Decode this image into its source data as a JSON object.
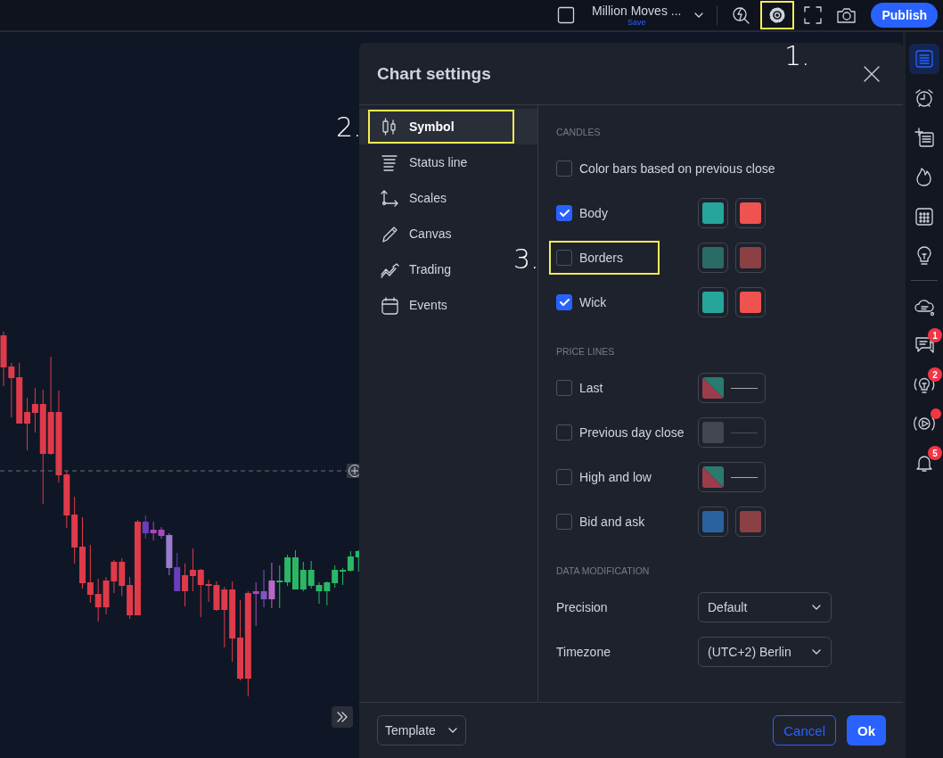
{
  "top_bar": {
    "title": "Million Moves ...",
    "subtitle": "Save",
    "settings_highlighted": true,
    "publish": "Publish"
  },
  "annotations": [
    "1.",
    "2.",
    "3."
  ],
  "dialog": {
    "title": "Chart settings",
    "nav": [
      {
        "label": "Symbol",
        "selected": true,
        "highlighted": true
      },
      {
        "label": "Status line",
        "selected": false,
        "highlighted": false
      },
      {
        "label": "Scales",
        "selected": false,
        "highlighted": false
      },
      {
        "label": "Canvas",
        "selected": false,
        "highlighted": false
      },
      {
        "label": "Trading",
        "selected": false,
        "highlighted": false
      },
      {
        "label": "Events",
        "selected": false,
        "highlighted": false
      }
    ],
    "sections": [
      {
        "heading": "CANDLES",
        "rows": [
          {
            "kind": "check",
            "label": "Color bars based on previous close",
            "checked": false,
            "highlighted": false,
            "swatches": []
          },
          {
            "kind": "check",
            "label": "Body",
            "checked": true,
            "highlighted": false,
            "swatches": [
              {
                "kind": "solid",
                "color": "#26a69a"
              },
              {
                "kind": "solid",
                "color": "#ef5350"
              }
            ]
          },
          {
            "kind": "check",
            "label": "Borders",
            "checked": false,
            "highlighted": true,
            "swatches": [
              {
                "kind": "solid",
                "color": "#2b6b66"
              },
              {
                "kind": "solid",
                "color": "#8b4043"
              }
            ]
          },
          {
            "kind": "check",
            "label": "Wick",
            "checked": true,
            "highlighted": false,
            "swatches": [
              {
                "kind": "solid",
                "color": "#26a69a"
              },
              {
                "kind": "solid",
                "color": "#ef5350"
              }
            ]
          }
        ]
      },
      {
        "heading": "PRICE LINES",
        "rows": [
          {
            "kind": "check",
            "label": "Last",
            "checked": false,
            "highlighted": false,
            "swatches": [
              {
                "kind": "line",
                "parts": [
                  {
                    "color": "#2b7a6e"
                  },
                  {
                    "color": "#9c3c4b"
                  }
                ]
              }
            ]
          },
          {
            "kind": "check",
            "label": "Previous day close",
            "checked": false,
            "highlighted": false,
            "swatches": [
              {
                "kind": "line",
                "parts": [
                  {
                    "color": "#434651"
                  }
                ]
              }
            ]
          },
          {
            "kind": "check",
            "label": "High and low",
            "checked": false,
            "highlighted": false,
            "swatches": [
              {
                "kind": "line",
                "parts": [
                  {
                    "color": "#2b7a6e"
                  },
                  {
                    "color": "#9c3c4b"
                  }
                ]
              }
            ]
          },
          {
            "kind": "check",
            "label": "Bid and ask",
            "checked": false,
            "highlighted": false,
            "swatches": [
              {
                "kind": "solid",
                "color": "#2a62a0"
              },
              {
                "kind": "solid",
                "color": "#8b4043"
              }
            ]
          }
        ]
      },
      {
        "heading": "DATA MODIFICATION",
        "rows": [
          {
            "kind": "select",
            "label": "Precision",
            "value": "Default"
          },
          {
            "kind": "select",
            "label": "Timezone",
            "value": "(UTC+2) Berlin"
          }
        ]
      }
    ],
    "footer": {
      "template": "Template",
      "cancel": "Cancel",
      "ok": "Ok"
    }
  },
  "right_toolbar": [
    {
      "kind": "watchlist",
      "selected": true,
      "dot": false
    },
    {
      "kind": "alarm",
      "selected": false,
      "dot": false
    },
    {
      "kind": "note",
      "selected": false,
      "dot": false
    },
    {
      "kind": "flame",
      "selected": false,
      "dot": false
    },
    {
      "kind": "calendar",
      "selected": false,
      "dot": false
    },
    {
      "kind": "bulb",
      "selected": false,
      "dot": false
    },
    {
      "kind": "divider"
    },
    {
      "kind": "cloud",
      "selected": false,
      "dot": false
    },
    {
      "kind": "chat",
      "selected": false,
      "dot": false,
      "badge": "1"
    },
    {
      "kind": "idea",
      "selected": false,
      "dot": false,
      "badge": "2"
    },
    {
      "kind": "stream",
      "selected": false,
      "dot": true
    },
    {
      "kind": "bell",
      "selected": false,
      "dot": false,
      "badge": "5"
    }
  ]
}
